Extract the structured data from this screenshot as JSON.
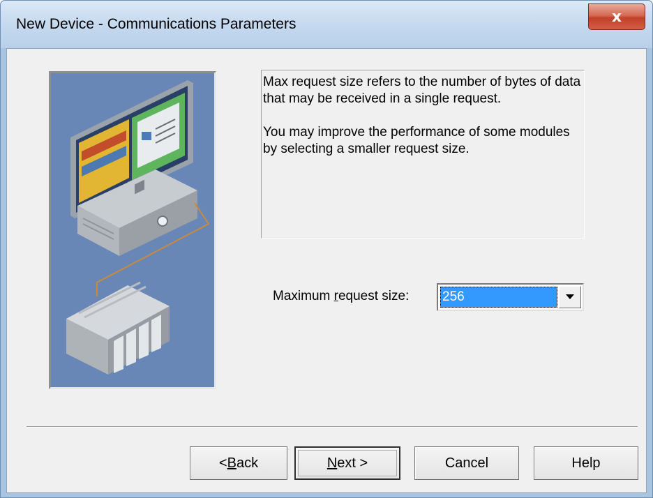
{
  "window": {
    "title": "New Device - Communications Parameters",
    "close_glyph": "x"
  },
  "info": {
    "paragraph1": "Max request size refers to the number of bytes of data that may be received in a single request.",
    "paragraph2": "You may improve the performance of some modules by selecting a smaller request size."
  },
  "max_request": {
    "label_pre": "Maximum ",
    "label_accel": "r",
    "label_post": "equest size:",
    "value": "256"
  },
  "buttons": {
    "back_pre": "< ",
    "back_accel": "B",
    "back_post": "ack",
    "next_accel": "N",
    "next_post": "ext >",
    "cancel": "Cancel",
    "help": "Help"
  },
  "icons": {
    "close": "close-icon",
    "dropdown": "chevron-down-icon",
    "illustration": "pc-and-plc-illustration"
  },
  "colors": {
    "selection": "#3399ff",
    "illustration_bg": "#6887b6",
    "close_button": "#c9482f"
  }
}
